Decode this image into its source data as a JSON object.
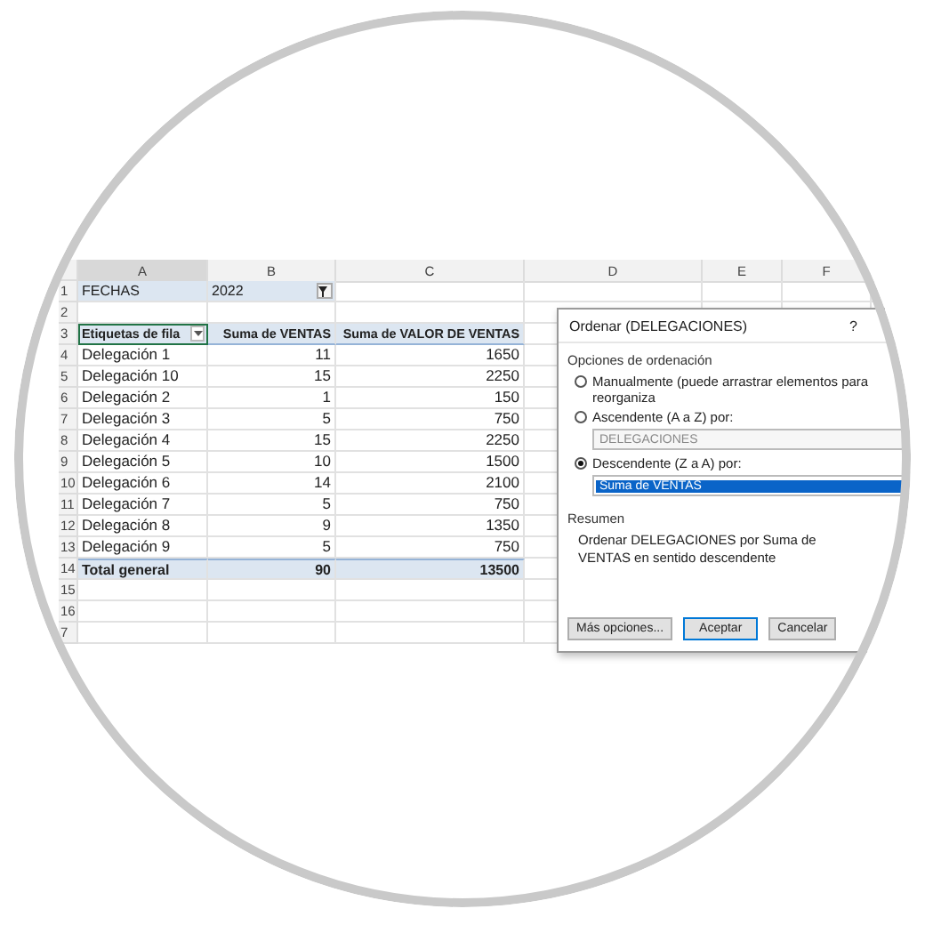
{
  "sheet": {
    "columns": [
      "A",
      "B",
      "C",
      "D",
      "E",
      "F"
    ],
    "rows": [
      {
        "number": "1",
        "kind": "filter",
        "cells": [
          "FECHAS",
          "2022"
        ]
      },
      {
        "number": "2",
        "kind": "empty",
        "cells": []
      },
      {
        "number": "3",
        "kind": "header",
        "cells": [
          "Etiquetas de fila",
          "Suma de VENTAS",
          "Suma de VALOR DE VENTAS"
        ]
      },
      {
        "number": "4",
        "kind": "data",
        "cells": [
          "Delegación 1",
          "11",
          "1650"
        ]
      },
      {
        "number": "5",
        "kind": "data",
        "cells": [
          "Delegación 10",
          "15",
          "2250"
        ]
      },
      {
        "number": "6",
        "kind": "data",
        "cells": [
          "Delegación 2",
          "1",
          "150"
        ]
      },
      {
        "number": "7",
        "kind": "data",
        "cells": [
          "Delegación 3",
          "5",
          "750"
        ]
      },
      {
        "number": "8",
        "kind": "data",
        "cells": [
          "Delegación 4",
          "15",
          "2250"
        ]
      },
      {
        "number": "9",
        "kind": "data",
        "cells": [
          "Delegación 5",
          "10",
          "1500"
        ]
      },
      {
        "number": "10",
        "kind": "data",
        "cells": [
          "Delegación 6",
          "14",
          "2100"
        ]
      },
      {
        "number": "11",
        "kind": "data",
        "cells": [
          "Delegación 7",
          "5",
          "750"
        ]
      },
      {
        "number": "12",
        "kind": "data",
        "cells": [
          "Delegación 8",
          "9",
          "1350"
        ]
      },
      {
        "number": "13",
        "kind": "data",
        "cells": [
          "Delegación 9",
          "5",
          "750"
        ]
      },
      {
        "number": "14",
        "kind": "total",
        "cells": [
          "Total general",
          "90",
          "13500"
        ]
      },
      {
        "number": "15",
        "kind": "empty",
        "cells": []
      },
      {
        "number": "16",
        "kind": "empty",
        "cells": []
      },
      {
        "number": "7",
        "kind": "empty",
        "cells": []
      }
    ]
  },
  "dialog": {
    "title": "Ordenar (DELEGACIONES)",
    "help": "?",
    "group_label": "Opciones de ordenación",
    "options": [
      {
        "label": "Manualmente (puede arrastrar elementos para reorganiza",
        "selected": false
      },
      {
        "label": "Ascendente (A a Z) por:",
        "selected": false,
        "field": {
          "value": "DELEGACIONES",
          "disabled": true
        }
      },
      {
        "label": "Descendente (Z a A) por:",
        "selected": true,
        "field": {
          "value": "Suma de VENTAS",
          "disabled": false
        }
      }
    ],
    "summary_label": "Resumen",
    "summary_text": "Ordenar DELEGACIONES por Suma de VENTAS en sentido descendente",
    "buttons": [
      {
        "label": "Más opciones...",
        "default": false
      },
      {
        "label": "Aceptar",
        "default": true
      },
      {
        "label": "Cancelar",
        "default": false
      }
    ]
  }
}
